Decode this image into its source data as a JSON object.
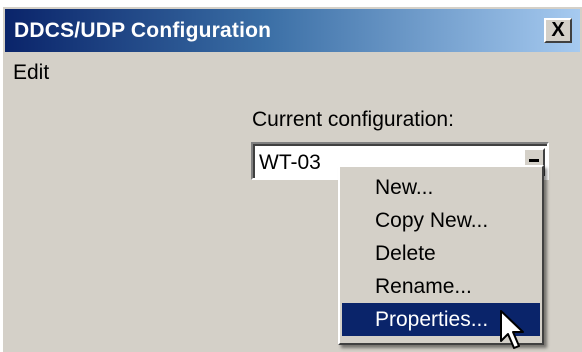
{
  "window": {
    "title": "DDCS/UDP Configuration",
    "close_label": "X"
  },
  "menubar": {
    "items": [
      {
        "label": "Edit"
      }
    ]
  },
  "config": {
    "label": "Current configuration:",
    "value": "WT-03"
  },
  "context_menu": {
    "items": [
      {
        "label": "New..."
      },
      {
        "label": "Copy New..."
      },
      {
        "label": "Delete"
      },
      {
        "label": "Rename..."
      },
      {
        "label": "Properties...",
        "selected": true
      }
    ]
  },
  "colors": {
    "titlebar_start": "#0a246a",
    "titlebar_end": "#a6caf0",
    "window_face": "#d4d0c8",
    "highlight": "#0a246a"
  },
  "icons": [
    "close-icon",
    "dropdown-icon",
    "mouse-cursor-icon"
  ]
}
